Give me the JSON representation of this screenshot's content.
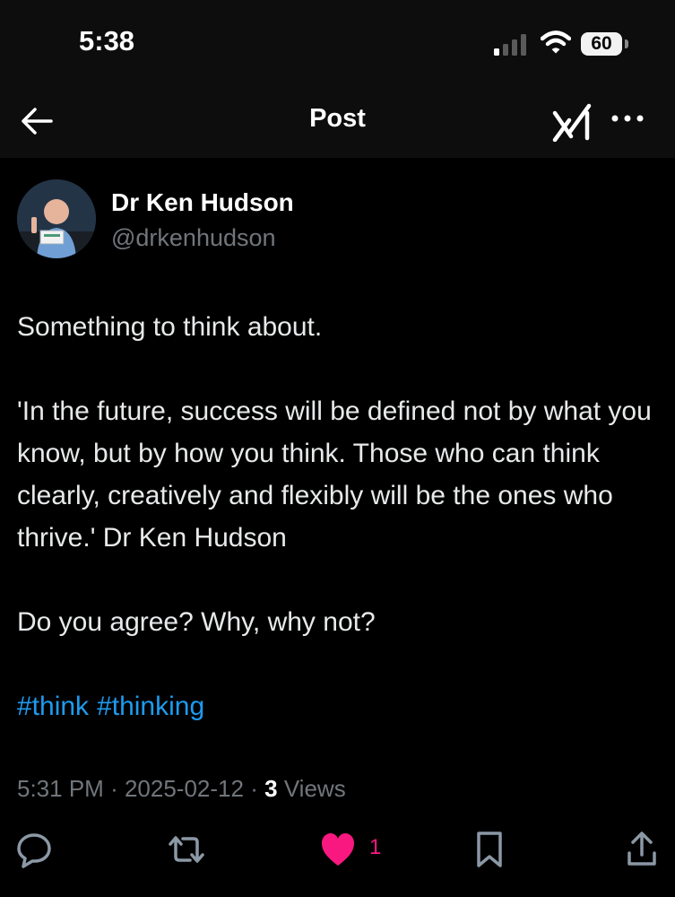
{
  "status_bar": {
    "time": "5:38",
    "battery": "60"
  },
  "nav": {
    "title": "Post"
  },
  "author": {
    "name": "Dr Ken Hudson",
    "handle": "@drkenhudson"
  },
  "tweet": {
    "line1": "Something to think about.",
    "quote": "'In the future, success will be defined not by what you know, but by how you think. Those who can think clearly, creatively and flexibly will be the ones who thrive.' Dr Ken Hudson",
    "question": "Do you agree? Why, why not?",
    "hashtags": [
      "#think",
      "#thinking"
    ]
  },
  "meta": {
    "time": "5:31 PM",
    "date": "2025-02-12",
    "views_count": "3",
    "views_label": "Views",
    "separator": "·"
  },
  "actions": {
    "like_count": "1"
  },
  "colors": {
    "accent": "#1d9bf0",
    "like": "#f91880",
    "secondary_text": "#71767b"
  }
}
